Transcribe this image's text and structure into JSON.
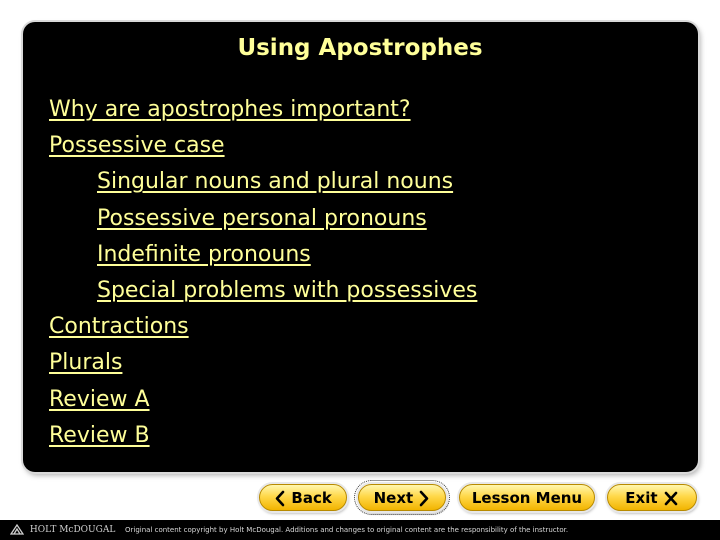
{
  "slide": {
    "title": "Using Apostrophes"
  },
  "toc": {
    "items": [
      {
        "label": "Why are apostrophes important? ",
        "level": 1
      },
      {
        "label": "Possessive case",
        "level": 1
      },
      {
        "label": "Singular nouns and plural nouns",
        "level": 2
      },
      {
        "label": "Possessive personal pronouns",
        "level": 2
      },
      {
        "label": "Indefinite pronouns",
        "level": 2
      },
      {
        "label": "Special problems with possessives",
        "level": 2
      },
      {
        "label": "Contractions",
        "level": 1
      },
      {
        "label": "Plurals",
        "level": 1
      },
      {
        "label": "Review A",
        "level": 1
      },
      {
        "label": "Review B",
        "level": 1
      }
    ]
  },
  "nav": {
    "back_label": "Back",
    "back_icon": "chevron-left-icon",
    "next_label": "Next",
    "next_icon": "chevron-right-icon",
    "lesson_menu_label": "Lesson Menu",
    "exit_label": "Exit",
    "exit_icon": "close-icon"
  },
  "footer": {
    "publisher": "HOLT McDOUGAL",
    "copyright": "Original content copyright by Holt McDougal. Additions and changes to original content are the responsibility of the instructor."
  },
  "colors": {
    "background": "#000000",
    "link_text": "#ffff99",
    "button_gold": "#ffd84a"
  }
}
